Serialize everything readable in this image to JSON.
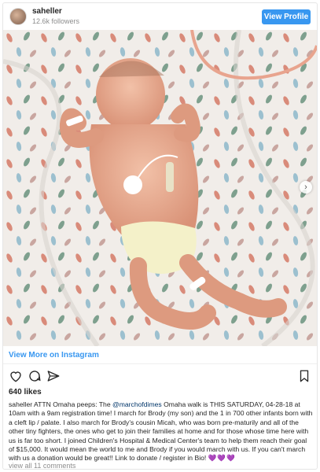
{
  "header": {
    "username": "saheller",
    "followers": "12.6k followers",
    "view_profile_label": "View Profile"
  },
  "photo": {
    "description_icon": "newborn-photo",
    "next_icon": "chevron-right-icon"
  },
  "view_more_label": "View More on Instagram",
  "actions": {
    "like_icon": "heart-icon",
    "comment_icon": "comment-icon",
    "share_icon": "share-icon",
    "save_icon": "bookmark-icon"
  },
  "likes": "640 likes",
  "caption": {
    "username": "saheller",
    "text_before": " ATTN Omaha peeps: The ",
    "mention": "@marchofdimes",
    "text_after": " Omaha walk is THIS SATURDAY, 04-28-18 at 10am with a 9am registration time! I march for Brody (my son) and the 1 in 700 other infants born with a cleft lip / palate. I also march for Brody's cousin Micah, who was born pre-maturily and all of the other tiny fighters, the ones who get to join their families at home and for those whose time here with us is far too short. I joined Children's Hospital & Medical Center's team to help them reach their goal of $15,000. It would mean the world to me and Brody if you would march with us. If you can't march with us a donation would be great!! Link to donate / register in Bio! ",
    "emoji": "💜💜💜"
  },
  "comments_link": "view all 11 comments",
  "colors": {
    "accent": "#3897f0",
    "text": "#262626",
    "muted": "#8e8e8e"
  }
}
